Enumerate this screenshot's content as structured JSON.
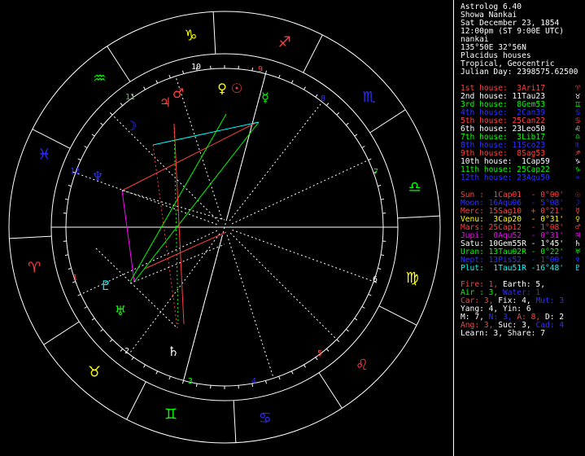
{
  "header": {
    "lines": [
      "Astrolog 6.40",
      "Showa Nankai",
      "Sat December 23, 1854",
      "12:00pm (ST 9:00E UTC)",
      "nankai",
      "135°50E 32°56N",
      "Placidus houses",
      "Tropical, Geocentric",
      "Julian Day: 2398575.62500"
    ]
  },
  "colors": {
    "fire": "#ff4040",
    "earth": "#ffff00",
    "air": "#00ff00",
    "water": "#3030ff",
    "white": "#ffffff",
    "cyan": "#00ffff",
    "gray": "#bbbbbb",
    "magenta": "#ff00ff"
  },
  "houses": [
    {
      "text": "1st house:  3Ari17",
      "sym": "♈",
      "color": "#ff4040"
    },
    {
      "text": "2nd house: 11Tau23",
      "sym": "♉",
      "color": "#ffffff"
    },
    {
      "text": "3rd house:  8Gem53",
      "sym": "♊",
      "color": "#00ff00"
    },
    {
      "text": "4th house:  2Can39",
      "sym": "♋",
      "color": "#3030ff"
    },
    {
      "text": "5th house: 25Can22",
      "sym": "♋",
      "color": "#ff4040"
    },
    {
      "text": "6th house: 23Leo50",
      "sym": "♌",
      "color": "#ffffff"
    },
    {
      "text": "7th house:  3Lib17",
      "sym": "♎",
      "color": "#00ff00"
    },
    {
      "text": "8th house: 11Sco23",
      "sym": "♏",
      "color": "#3030ff"
    },
    {
      "text": "9th house:  8Sag53",
      "sym": "♐",
      "color": "#ff4040"
    },
    {
      "text": "10th house:  1Cap59",
      "sym": "♑",
      "color": "#ffffff"
    },
    {
      "text": "11th house: 25Cap22",
      "sym": "♑",
      "color": "#00ff00"
    },
    {
      "text": "12th house: 23Aqu50",
      "sym": "♒",
      "color": "#3030ff"
    }
  ],
  "planets": [
    {
      "text": "Sun :  1Cap01  - 0°00'",
      "sym": "☉",
      "color": "#ff4040"
    },
    {
      "text": "Moon: 16Aqu06  - 5°08'",
      "sym": "☽",
      "color": "#3030ff"
    },
    {
      "text": "Merc: 15Sag10  + 0°21'",
      "sym": "☿",
      "color": "#ff4040"
    },
    {
      "text": "Venu:  3Cap20  - 0°31'",
      "sym": "♀",
      "color": "#ffff00"
    },
    {
      "text": "Mars: 25Cap12  - 1°08'",
      "sym": "♂",
      "color": "#ff4040"
    },
    {
      "text": "Jupi:  0Aqu52  - 0°31'",
      "sym": "♃",
      "color": "#ff00ff"
    },
    {
      "text": "Satu: 10Gem55R - 1°45'",
      "sym": "♄",
      "color": "#ffffff"
    },
    {
      "text": "Uran: 13Tau02R - 0°22'",
      "sym": "♅",
      "color": "#00ff00"
    },
    {
      "text": "Nept: 13Pis52  - 1°00'",
      "sym": "♆",
      "color": "#3030ff"
    },
    {
      "text": "Plut:  1Tau51R -16°48'",
      "sym": "♇",
      "color": "#00ffff"
    }
  ],
  "stats": [
    {
      "segs": [
        {
          "t": "Fire: 1, ",
          "c": "#ff4040"
        },
        {
          "t": "Earth: 5,",
          "c": "#ffffff"
        }
      ]
    },
    {
      "segs": [
        {
          "t": "Air : 3, ",
          "c": "#00ff00"
        },
        {
          "t": "Water: 1",
          "c": "#3030ff"
        }
      ]
    },
    {
      "segs": [
        {
          "t": "Car: 3, ",
          "c": "#ff4040"
        },
        {
          "t": "Fix: 4, ",
          "c": "#ffffff"
        },
        {
          "t": "Mut: 3",
          "c": "#3030ff"
        }
      ]
    },
    {
      "segs": [
        {
          "t": "Yang: 4, Yin: 6",
          "c": "#ffffff"
        }
      ]
    },
    {
      "segs": [
        {
          "t": "M: 7, ",
          "c": "#ffffff"
        },
        {
          "t": "N: 3, ",
          "c": "#3030ff"
        },
        {
          "t": "A: 8, ",
          "c": "#ff4040"
        },
        {
          "t": "D: 2",
          "c": "#ffffff"
        }
      ]
    },
    {
      "segs": [
        {
          "t": "Ang: 3, ",
          "c": "#ff4040"
        },
        {
          "t": "Suc: 3, ",
          "c": "#ffffff"
        },
        {
          "t": "Cad: 4",
          "c": "#3030ff"
        }
      ]
    },
    {
      "segs": [
        {
          "t": "Learn: 3, Share: 7",
          "c": "#ffffff"
        }
      ]
    }
  ],
  "wheel": {
    "house_numbers": [
      "1",
      "2",
      "3",
      "4",
      "5",
      "6",
      "7",
      "8",
      "9",
      "10",
      "11",
      "12"
    ],
    "signs": [
      {
        "sym": "♈",
        "color": "#ff4040"
      },
      {
        "sym": "♉",
        "color": "#ffff00"
      },
      {
        "sym": "♊",
        "color": "#00ff00"
      },
      {
        "sym": "♋",
        "color": "#3030ff"
      },
      {
        "sym": "♌",
        "color": "#ff4040"
      },
      {
        "sym": "♍",
        "color": "#ffff00"
      },
      {
        "sym": "♎",
        "color": "#00ff00"
      },
      {
        "sym": "♏",
        "color": "#3030ff"
      },
      {
        "sym": "♐",
        "color": "#ff4040"
      },
      {
        "sym": "♑",
        "color": "#ffff00"
      },
      {
        "sym": "♒",
        "color": "#00ff00"
      },
      {
        "sym": "♓",
        "color": "#3030ff"
      }
    ],
    "planet_glyphs": [
      {
        "sym": "♆",
        "color": "#3030ff"
      },
      {
        "sym": "♅",
        "color": "#00ff00"
      },
      {
        "sym": "♄",
        "color": "#ffffff"
      },
      {
        "sym": "☽",
        "color": "#3030ff"
      },
      {
        "sym": "♃",
        "color": "#ff4040"
      },
      {
        "sym": "♂",
        "color": "#ff4040"
      },
      {
        "sym": "♀",
        "color": "#ffff00"
      },
      {
        "sym": "☉",
        "color": "#ff4040"
      },
      {
        "sym": "☿",
        "color": "#00ff00"
      },
      {
        "sym": "♇",
        "color": "#00ffff"
      }
    ]
  }
}
